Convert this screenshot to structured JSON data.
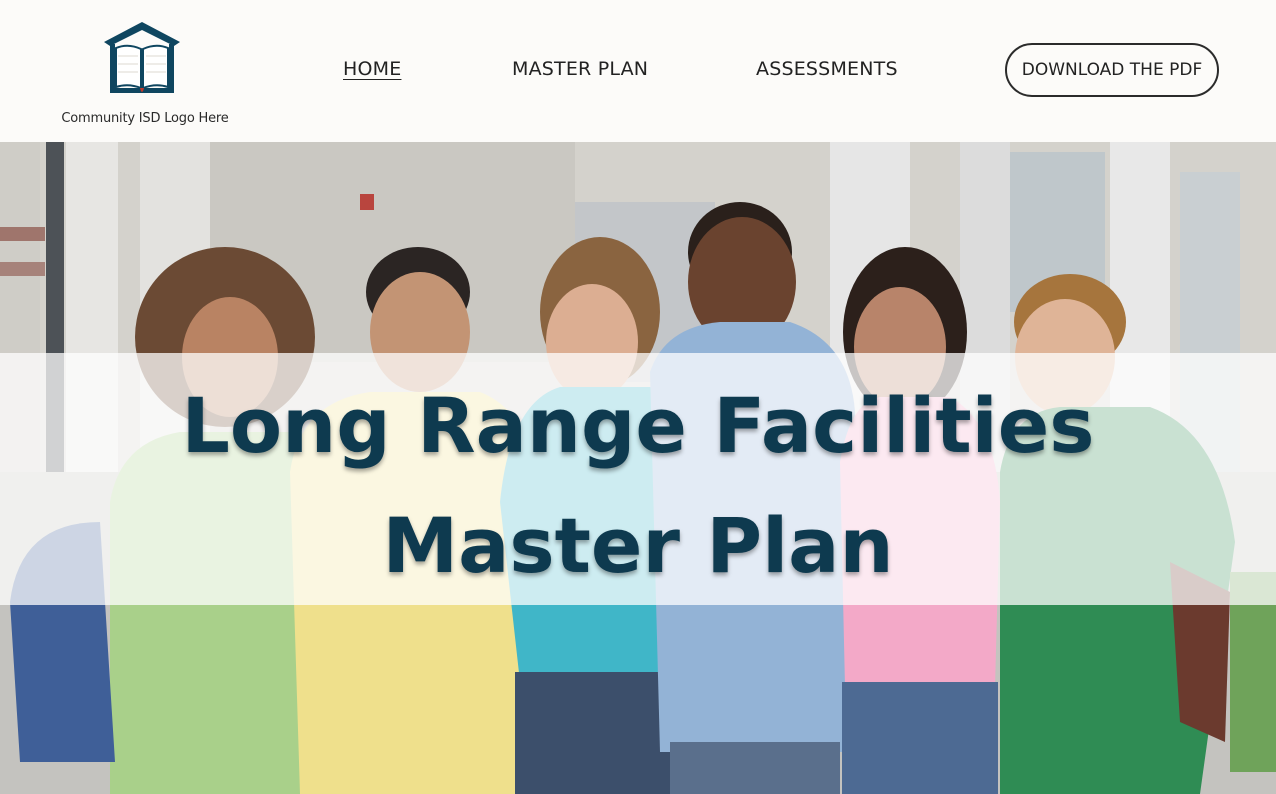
{
  "logo": {
    "caption": "Community ISD Logo Here",
    "icon": "house-book-icon",
    "brand_color": "#0f4660"
  },
  "nav": {
    "items": [
      {
        "label": "HOME",
        "active": true
      },
      {
        "label": "MASTER PLAN",
        "active": false
      },
      {
        "label": "ASSESSMENTS",
        "active": false
      }
    ],
    "cta_label": "DOWNLOAD THE PDF"
  },
  "hero": {
    "title": "Long Range Facilities Master Plan",
    "title_color": "#0e3a4f",
    "image": "students-group-photo"
  }
}
